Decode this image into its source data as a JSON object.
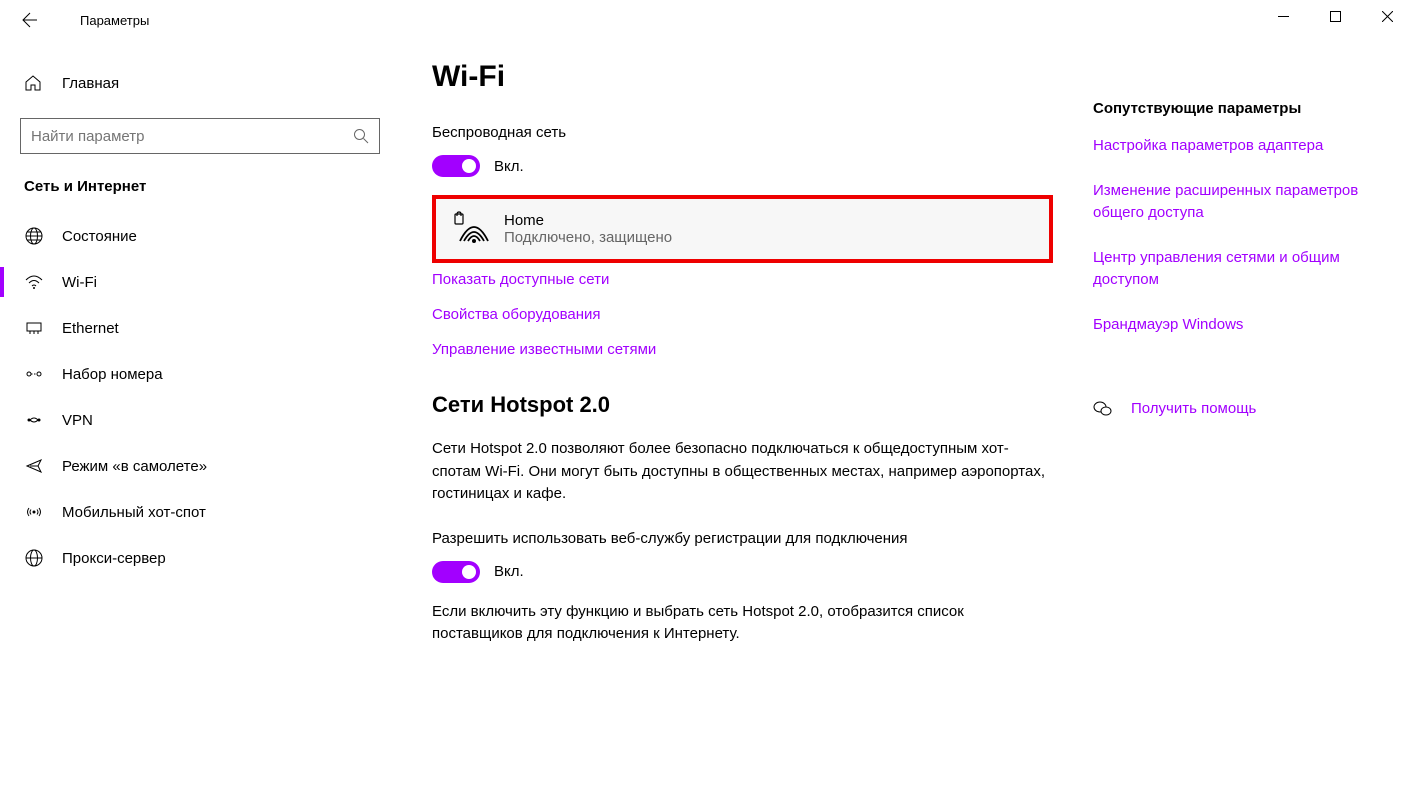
{
  "window": {
    "title": "Параметры"
  },
  "sidebar": {
    "home": "Главная",
    "search_placeholder": "Найти параметр",
    "category": "Сеть и Интернет",
    "items": [
      {
        "label": "Состояние"
      },
      {
        "label": "Wi-Fi"
      },
      {
        "label": "Ethernet"
      },
      {
        "label": "Набор номера"
      },
      {
        "label": "VPN"
      },
      {
        "label": "Режим «в самолете»"
      },
      {
        "label": "Мобильный хот-спот"
      },
      {
        "label": "Прокси-сервер"
      }
    ]
  },
  "main": {
    "title": "Wi-Fi",
    "wireless_label": "Беспроводная сеть",
    "toggle1_state": "Вкл.",
    "network": {
      "name": "Home",
      "status": "Подключено, защищено"
    },
    "links": {
      "show_networks": "Показать доступные сети",
      "hw_props": "Свойства оборудования",
      "manage_known": "Управление известными сетями"
    },
    "hotspot": {
      "title": "Сети Hotspot 2.0",
      "desc": "Сети Hotspot 2.0 позволяют более безопасно подключаться к общедоступным хот-спотам Wi-Fi. Они могут быть доступны в общественных местах, например аэропортах, гостиницах и кафе.",
      "allow_label": "Разрешить использовать веб-службу регистрации для подключения",
      "toggle2_state": "Вкл.",
      "desc2": "Если включить эту функцию и выбрать сеть Hotspot 2.0, отобразится список поставщиков для подключения к Интернету."
    }
  },
  "aside": {
    "header": "Сопутствующие параметры",
    "links": [
      "Настройка параметров адаптера",
      "Изменение расширенных параметров общего доступа",
      "Центр управления сетями и общим доступом",
      "Брандмауэр Windows"
    ],
    "help": "Получить помощь"
  }
}
